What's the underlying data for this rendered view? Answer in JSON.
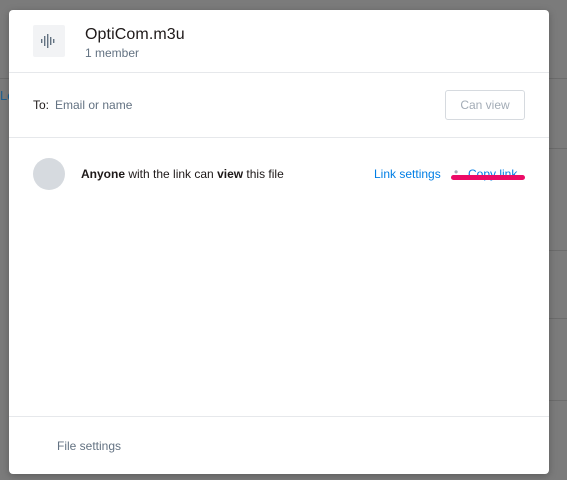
{
  "backdrop": {
    "partial_text": "Le"
  },
  "header": {
    "file_icon": "audio-file-icon",
    "file_name": "OptiCom.m3u",
    "member_count": "1 member"
  },
  "share": {
    "to_label": "To:",
    "to_placeholder": "Email or name",
    "permission_button": "Can view"
  },
  "link": {
    "subject": "Anyone",
    "middle_text": " with the link can ",
    "permission": "view",
    "tail_text": " this file",
    "link_settings_label": "Link settings",
    "separator": "•",
    "copy_link_label": "Copy link"
  },
  "footer": {
    "file_settings_label": "File settings"
  },
  "colors": {
    "link_blue": "#007ee5",
    "annotation_pink": "#ec0b67",
    "overlay_gray": "#7b7b7b"
  }
}
